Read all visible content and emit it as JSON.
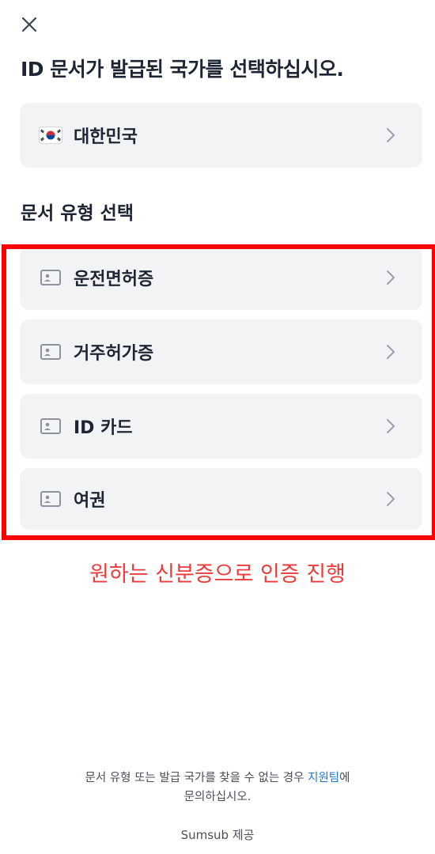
{
  "header": {
    "close_icon": "close-icon",
    "title": "ID 문서가 발급된 국가를 선택하십시오."
  },
  "country": {
    "flag_icon": "korea-flag-icon",
    "name": "대한민국"
  },
  "doc_section": {
    "title": "문서 유형 선택",
    "items": [
      {
        "label": "운전면허증",
        "icon": "id-card-icon"
      },
      {
        "label": "거주허가증",
        "icon": "id-card-icon"
      },
      {
        "label": "ID 카드",
        "icon": "id-card-icon"
      },
      {
        "label": "여권",
        "icon": "id-card-icon"
      }
    ]
  },
  "annotation": {
    "text": "원하는 신분증으로 인증 진행",
    "color": "#ee3a3a",
    "box_color": "#ff0000"
  },
  "footer": {
    "text_before": "문서 유형 또는 발급 국가를 찾을 수 없는 경우 ",
    "link": "지원팀",
    "text_after_1": "에",
    "text_after_2": "문의하십시오.",
    "link_color": "#1a7be0",
    "powered_by": "Sumsub 제공"
  }
}
